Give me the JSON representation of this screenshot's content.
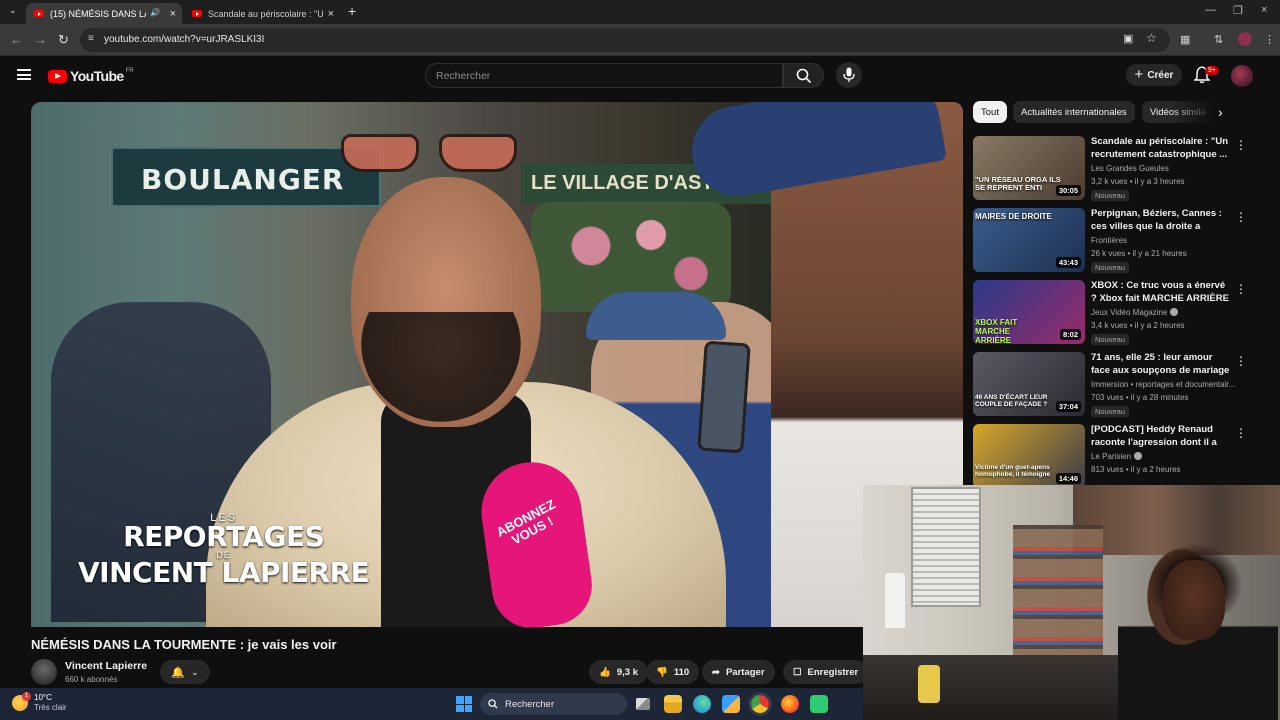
{
  "browser": {
    "tabs": [
      {
        "title": "(15) NÉMÉSIS DANS LA TOURMENTE",
        "active": true
      },
      {
        "title": "Scandale au périscolaire : \"Un re",
        "active": false
      }
    ],
    "new_tab": "+",
    "url": "youtube.com/watch?v=urJRASLKI3I"
  },
  "youtube": {
    "logo_text": "YouTube",
    "country_code": "FR",
    "search_placeholder": "Rechercher",
    "create_label": "Créer",
    "notification_count": "9+"
  },
  "player": {
    "overlay_les": "LES",
    "overlay_reportages": "REPORTAGES",
    "overlay_de": "DE",
    "overlay_name": "VINCENT LAPIERRE",
    "shop_sign": "BOULANGER",
    "village_sign": "LE VILLAGE D'ASTE",
    "mic_text_1": "ABONNEZ",
    "mic_text_2": "VOUS !"
  },
  "video": {
    "title": "NÉMÉSIS DANS LA TOURMENTE : je vais les voir",
    "channel": "Vincent Lapierre",
    "subscribers": "660 k abonnés",
    "likes": "9,3 k",
    "dislikes": "110",
    "share_label": "Partager",
    "save_label": "Enregistrer"
  },
  "chips": [
    "Tout",
    "Actualités internationales",
    "Vidéos simila"
  ],
  "recommendations": [
    {
      "title": "Scandale au périscolaire : \"Un recrutement catastrophique ...",
      "channel": "Les Grandes Gueules",
      "meta": "3,2 k vues • il y a 3 heures",
      "badge": "Nouveau",
      "duration": "30:05",
      "thumb_text": "\"UN RÉSEAU ORGA ILS SE REPRENT ENTI",
      "thumb_color": "#6a5a4a"
    },
    {
      "title": "Perpignan, Béziers, Cannes : ces villes que la droite a sauvé...",
      "channel": "Frontières",
      "meta": "26 k vues • il y a 21 heures",
      "badge": "Nouveau",
      "duration": "43:43",
      "thumb_text": "MAIRES DE DROITE",
      "thumb_color": "#2a4a7a"
    },
    {
      "title": "XBOX : Ce truc vous a énervé ? Xbox fait MARCHE ARRIÈRE 😊",
      "channel": "Jeux Vidéo Magazine",
      "meta": "3,4 k vues • il y a 2 heures",
      "badge": "Nouveau",
      "duration": "8:02",
      "thumb_text": "XBOX FAIT MARCHE ARRIÈRE",
      "thumb_color": "#2f6e2a",
      "verified": true
    },
    {
      "title": "71 ans, elle 25 : leur amour face aux soupçons de mariage blanc",
      "channel": "Immersion • reportages et documentair...",
      "meta": "703 vues • il y a 28 minutes",
      "badge": "Nouveau",
      "duration": "37:04",
      "thumb_text": "46 ANS D'ÉCART LEUR COUPLE DE FAÇADE ?",
      "thumb_color": "#4a4a58"
    },
    {
      "title": "[PODCAST] Heddy Renaud raconte l'agression dont il a ét...",
      "channel": "Le Parisien",
      "meta": "813 vues • il y a 2 heures",
      "badge": "Nouveau",
      "duration": "14:46",
      "thumb_text": "Victime d'un guet-apens homophobe, il témoigne",
      "thumb_color": "#c8a020",
      "verified": true
    }
  ],
  "taskbar": {
    "weather_temp": "10°C",
    "weather_desc": "Très clair",
    "weather_badge": "1",
    "search_label": "Rechercher"
  }
}
